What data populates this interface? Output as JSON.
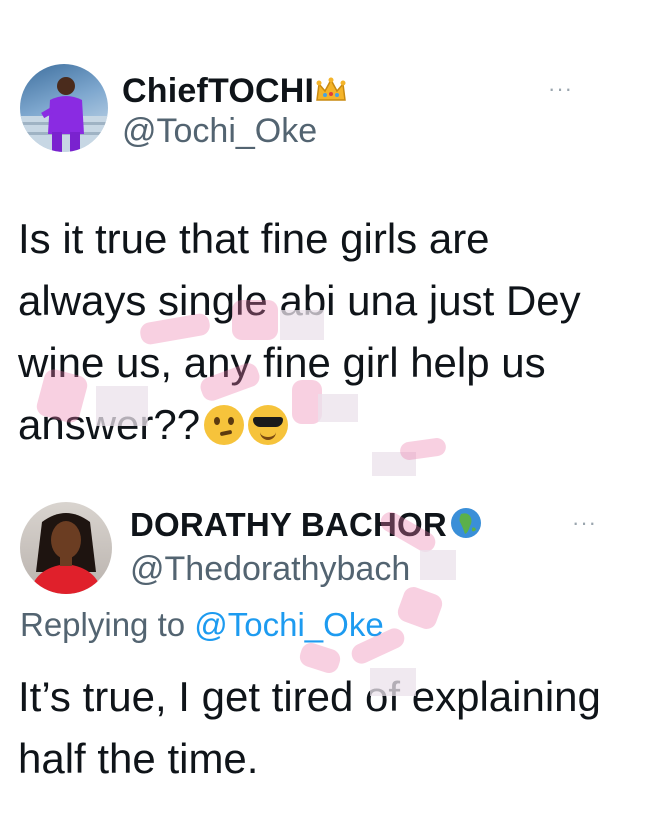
{
  "tweet1": {
    "display_name": "ChiefTOCHI",
    "handle": "@Tochi_Oke",
    "name_badge_icon": "crown-emoji",
    "more_label": "···",
    "text": "Is it true that fine girls are always single abi una just Dey wine us, any fine girl help us answer??",
    "emojis": [
      "thinking-face-emoji",
      "smiling-face-with-sunglasses-emoji"
    ]
  },
  "tweet2": {
    "display_name": "DORATHY BACHOR",
    "handle": "@Thedorathybach",
    "name_badge_icon": "globe-africa-emoji",
    "more_label": "···",
    "replying_prefix": "Replying to ",
    "replying_mention": "@Tochi_Oke",
    "text": "It’s true, I get tired of explaining half the time."
  },
  "colors": {
    "text_primary": "#0f1419",
    "text_secondary": "#536471",
    "link": "#1d9bf0",
    "watermark_pink": "#ec78aa"
  }
}
